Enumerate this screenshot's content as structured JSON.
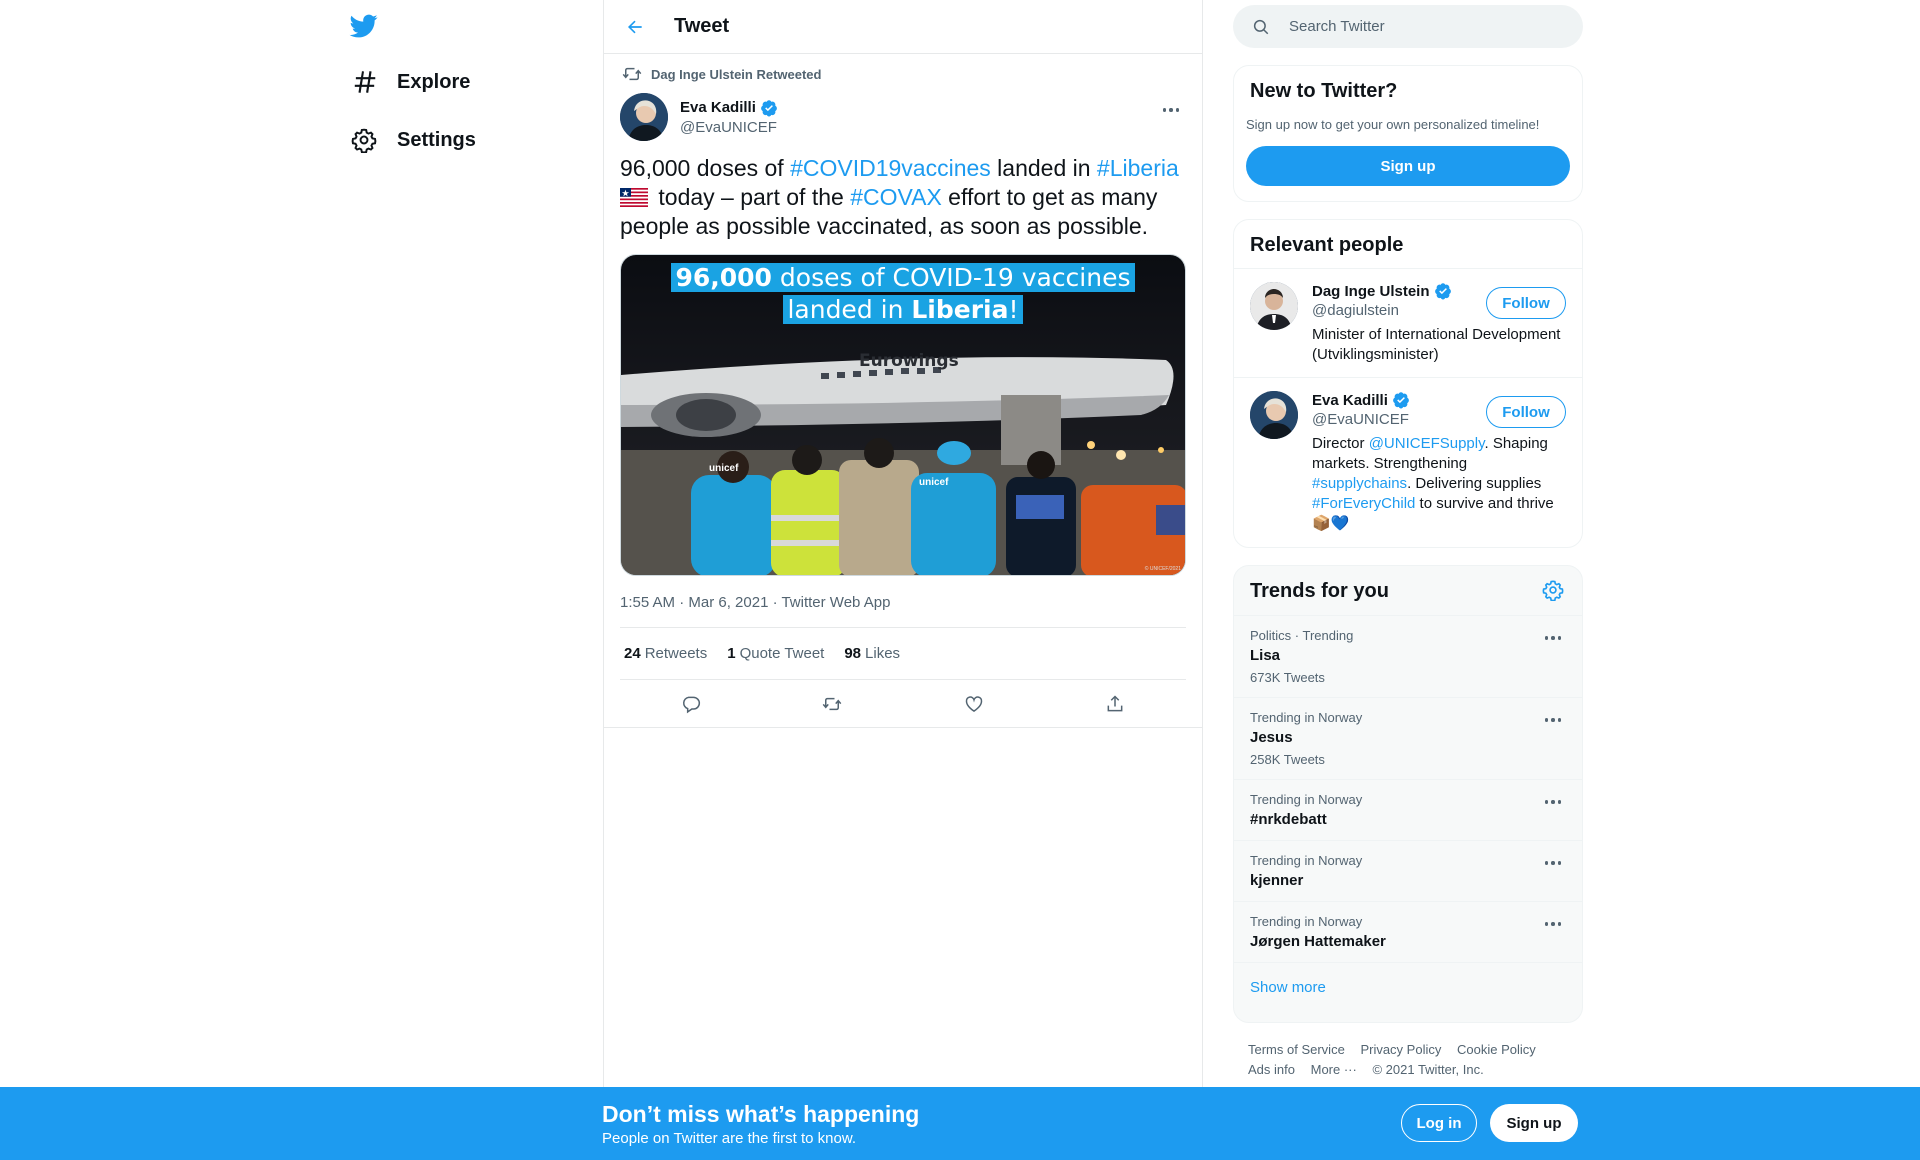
{
  "colors": {
    "accent": "#1d9bf0",
    "text": "#0f1419",
    "muted": "#536471",
    "border": "#e7e9ea"
  },
  "nav": {
    "logo_icon": "twitter-bird-icon",
    "items": [
      {
        "label": "Explore",
        "icon": "hashtag-icon"
      },
      {
        "label": "Settings",
        "icon": "gear-icon"
      }
    ]
  },
  "header": {
    "title": "Tweet",
    "back_icon": "arrow-left-icon"
  },
  "tweet": {
    "retweeted_by": "Dag Inge Ulstein Retweeted",
    "author_name": "Eva Kadilli",
    "author_handle": "@EvaUNICEF",
    "text_parts": {
      "p1": "96,000 doses of ",
      "tag1": "#COVID19vaccines",
      "p2": " landed in ",
      "tag2": "#Liberia",
      "p3": " today – part of the ",
      "tag3": "#COVAX",
      "p4": " effort to get as many people as possible vaccinated, as soon as possible."
    },
    "flag_icon": "liberia-flag-icon",
    "media": {
      "caption_line1_bold": "96,000",
      "caption_line1_rest": " doses of COVID-19 vaccines",
      "caption_line2_pre": "landed in ",
      "caption_line2_bold": "Liberia",
      "caption_line2_post": "!",
      "plane_text": "Eurowings",
      "vest_text": "unicef",
      "credit": "© UNICEF/2021"
    },
    "timestamp": "1:55 AM · Mar 6, 2021 · Twitter Web App",
    "stats": {
      "retweets_count": "24",
      "retweets_label": "Retweets",
      "quotes_count": "1",
      "quotes_label": "Quote Tweet",
      "likes_count": "98",
      "likes_label": "Likes"
    }
  },
  "search": {
    "placeholder": "Search Twitter"
  },
  "new_to_twitter": {
    "title": "New to Twitter?",
    "subtitle": "Sign up now to get your own personalized timeline!",
    "button": "Sign up"
  },
  "relevant_people": {
    "title": "Relevant people",
    "people": [
      {
        "name": "Dag Inge Ulstein",
        "handle": "@dagiulstein",
        "follow": "Follow",
        "bio": "Minister of International Development (Utviklingsminister)"
      },
      {
        "name": "Eva Kadilli",
        "handle": "@EvaUNICEF",
        "follow": "Follow",
        "bio_parts": {
          "p1": "Director ",
          "tag1": "@UNICEFSupply",
          "p2": ". Shaping markets. Strengthening ",
          "tag2": "#supplychains",
          "p3": ". Delivering supplies ",
          "tag3": "#ForEveryChild",
          "p4": " to survive and thrive ",
          "emoji": "📦💙"
        }
      }
    ]
  },
  "trends": {
    "title": "Trends for you",
    "items": [
      {
        "context": "Politics · Trending",
        "name": "Lisa",
        "count": "673K Tweets"
      },
      {
        "context": "Trending in Norway",
        "name": "Jesus",
        "count": "258K Tweets"
      },
      {
        "context": "Trending in Norway",
        "name": "#nrkdebatt",
        "count": ""
      },
      {
        "context": "Trending in Norway",
        "name": "kjenner",
        "count": ""
      },
      {
        "context": "Trending in Norway",
        "name": "Jørgen Hattemaker",
        "count": ""
      }
    ],
    "show_more": "Show more"
  },
  "footer": {
    "terms": "Terms of Service",
    "privacy": "Privacy Policy",
    "cookie": "Cookie Policy",
    "ads": "Ads info",
    "more": "More ···",
    "copyright": "© 2021 Twitter, Inc."
  },
  "banner": {
    "title": "Don’t miss what’s happening",
    "subtitle": "People on Twitter are the first to know.",
    "login": "Log in",
    "signup": "Sign up"
  }
}
